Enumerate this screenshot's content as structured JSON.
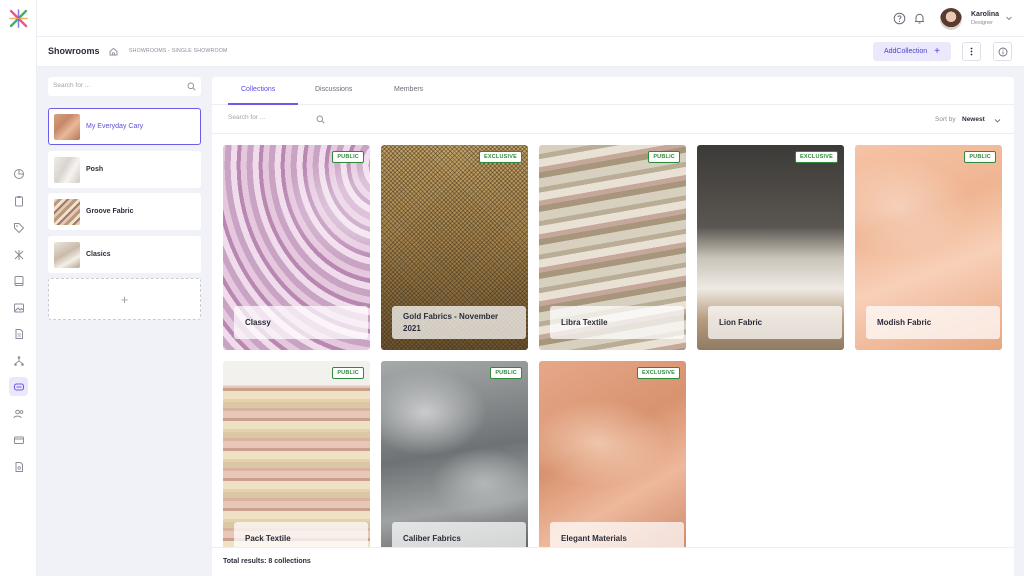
{
  "colors": {
    "accent": "#6c5ce7",
    "badge_green": "#2f8a3a",
    "background": "#f1f2f7"
  },
  "topbar": {
    "help_icon": "help-circle-icon",
    "bell_icon": "bell-icon",
    "user": {
      "name": "Karolina",
      "role": "Designer"
    }
  },
  "header": {
    "title": "Showrooms",
    "breadcrumb": "SHOWROOMS - SINGLE SHOWROOM",
    "add_label": "AddCollection",
    "add_icon": "+"
  },
  "sidebar": {
    "search_placeholder": "Search for ...",
    "items": [
      {
        "label": "My Everyday Cary"
      },
      {
        "label": "Posh"
      },
      {
        "label": "Groove Fabric"
      },
      {
        "label": "Clasics"
      }
    ],
    "add_icon": "+"
  },
  "tabs": [
    {
      "label": "Collections"
    },
    {
      "label": "Discussions"
    },
    {
      "label": "Members"
    }
  ],
  "toolbar": {
    "search_placeholder": "Search for ...",
    "sort_label": "Sort by",
    "sort_value": "Newest"
  },
  "collections": [
    {
      "name": "Classy",
      "badge": "PUBLIC"
    },
    {
      "name": "Gold Fabrics - November 2021",
      "badge": "EXCLUSIVE"
    },
    {
      "name": "Libra Textile",
      "badge": "PUBLIC"
    },
    {
      "name": "Lion Fabric",
      "badge": "EXCLUSIVE"
    },
    {
      "name": "Modish Fabric",
      "badge": "PUBLIC"
    },
    {
      "name": "Pack Textile",
      "badge": "PUBLIC"
    },
    {
      "name": "Caliber Fabrics",
      "badge": "PUBLIC"
    },
    {
      "name": "Elegant Materials",
      "badge": "EXCLUSIVE"
    }
  ],
  "footer": {
    "total": "Total results: 8 collections"
  }
}
